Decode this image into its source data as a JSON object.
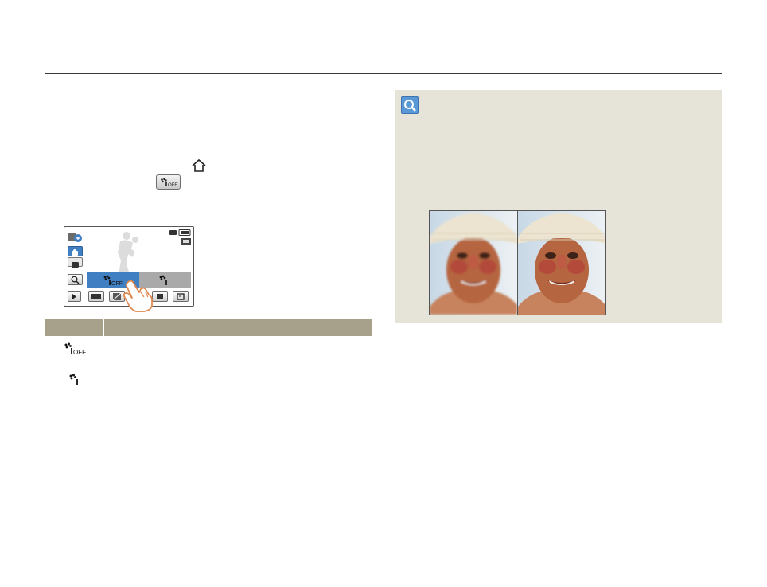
{
  "header": {
    "rule": ""
  },
  "icons": {
    "home": "home-icon",
    "anti_shake_off": "anti-shake-off-icon",
    "anti_shake_on": "anti-shake-on-icon",
    "magnifier": "magnifier-icon",
    "touch_hand": "hand-pointer-icon"
  },
  "camera_screen": {
    "options": [
      {
        "icon": "anti-shake-off-icon",
        "selected": true
      },
      {
        "icon": "anti-shake-on-icon",
        "selected": false
      }
    ],
    "status_icons": [
      "battery-icon",
      "quality-icon"
    ]
  },
  "table": {
    "header": [
      "",
      ""
    ],
    "rows": [
      {
        "icon": "anti-shake-off-icon",
        "description": ""
      },
      {
        "icon": "anti-shake-on-icon",
        "description": ""
      }
    ]
  },
  "colors": {
    "table_header": "#a7a08a",
    "tip_background": "#e6e3d9",
    "selected_option": "#3f7fc2",
    "tip_icon": "#5a98d6"
  },
  "tip": {
    "images": [
      "comparison-photo-left",
      "comparison-photo-right"
    ]
  }
}
